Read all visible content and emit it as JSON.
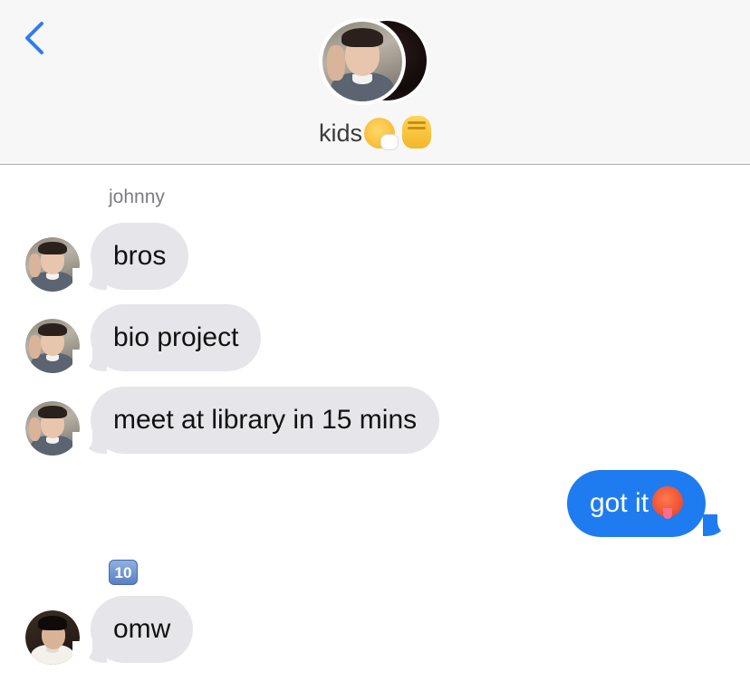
{
  "header": {
    "back_icon": "chevron-left-icon",
    "group_name": "kids",
    "group_emojis": [
      "sneezing-face-emoji",
      "raised-fist-emoji"
    ],
    "accent_color": "#1f7cf0"
  },
  "thread": {
    "sender_name": "johnny",
    "incoming": [
      {
        "text": "bros"
      },
      {
        "text": "bio project"
      },
      {
        "text": "meet at library in 15 mins"
      }
    ],
    "outgoing": [
      {
        "text": "got it",
        "emoji": "hot-face-emoji"
      }
    ],
    "second_sender_badge": "10",
    "second_sender_message": "omw"
  },
  "colors": {
    "incoming_bubble": "#e5e5ea",
    "outgoing_bubble": "#1f7cf0",
    "header_bg": "#f7f7f7"
  }
}
